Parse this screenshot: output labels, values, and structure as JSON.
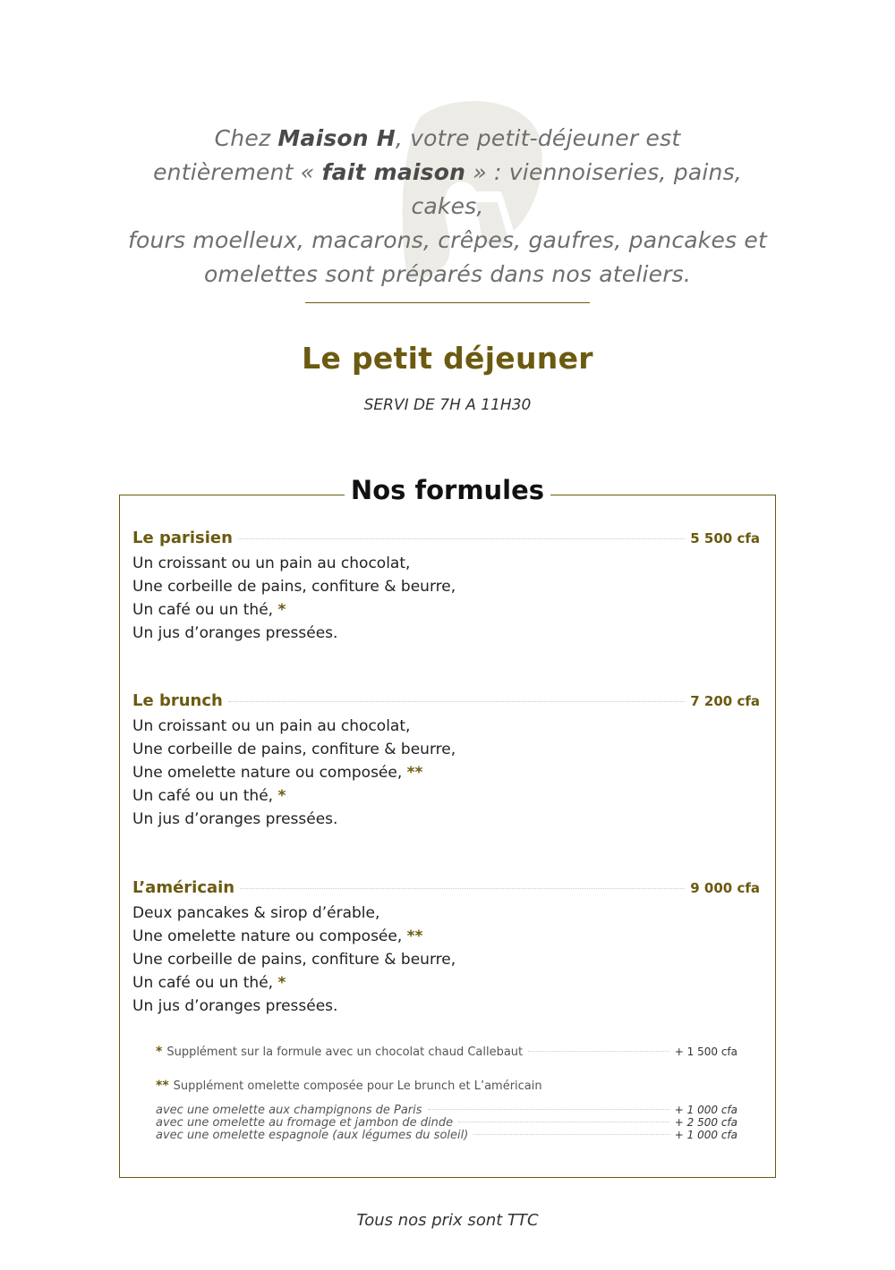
{
  "intro": {
    "p1": "Chez ",
    "brand": "Maison H",
    "p2": ", votre petit-déjeuner est",
    "p3": "entièrement « ",
    "made": "fait maison",
    "p4": " » : viennoiseries, pains, cakes,",
    "p5": "fours moelleux, macarons, crêpes, gaufres, pancakes et",
    "p6": "omelettes sont préparés dans nos ateliers."
  },
  "title": "Le petit déjeuner",
  "served": "SERVI DE 7H A 11H30",
  "section_title": "Nos formules",
  "formulas": [
    {
      "name": "Le parisien",
      "price": "5 500 cfa",
      "lines": [
        {
          "text": "Un croissant ou un pain au chocolat,",
          "mark": ""
        },
        {
          "text": "Une corbeille de pains, confiture & beurre,",
          "mark": ""
        },
        {
          "text": "Un café ou un thé, ",
          "mark": "*"
        },
        {
          "text": "Un jus d’oranges pressées.",
          "mark": ""
        }
      ]
    },
    {
      "name": "Le brunch",
      "price": "7 200 cfa",
      "lines": [
        {
          "text": "Un croissant ou un pain au chocolat,",
          "mark": ""
        },
        {
          "text": "Une corbeille de pains, confiture & beurre,",
          "mark": ""
        },
        {
          "text": "Une omelette nature ou composée, ",
          "mark": "**"
        },
        {
          "text": "Un café ou un thé, ",
          "mark": "*"
        },
        {
          "text": "Un jus d’oranges pressées.",
          "mark": ""
        }
      ]
    },
    {
      "name": "L’américain",
      "price": "9 000 cfa",
      "lines": [
        {
          "text": "Deux pancakes & sirop d’érable,",
          "mark": ""
        },
        {
          "text": "Une omelette nature ou composée, ",
          "mark": "**"
        },
        {
          "text": "Une corbeille de pains, confiture & beurre,",
          "mark": ""
        },
        {
          "text": "Un café ou un thé, ",
          "mark": "*"
        },
        {
          "text": "Un jus d’oranges pressées.",
          "mark": ""
        }
      ]
    }
  ],
  "notes": {
    "supp1_mark": "*",
    "supp1_text": "Supplément sur la formule avec un chocolat chaud Callebaut",
    "supp1_price": "+ 1 500 cfa",
    "supp2_mark": "**",
    "supp2_text": "Supplément omelette composée pour Le brunch et L’américain",
    "options": [
      {
        "text": "avec une omelette aux champignons de Paris",
        "price": "+ 1 000 cfa"
      },
      {
        "text": "avec une omelette au fromage et jambon de dinde",
        "price": "+ 2 500 cfa"
      },
      {
        "text": "avec une omelette espagnole (aux légumes du soleil)",
        "price": "+ 1 000 cfa"
      }
    ]
  },
  "footer": "Tous nos prix sont TTC",
  "colors": {
    "accent": "#6b5a10",
    "text": "#1a1a1a",
    "muted": "#6e6e6e",
    "watermark": "#ecebe5"
  }
}
